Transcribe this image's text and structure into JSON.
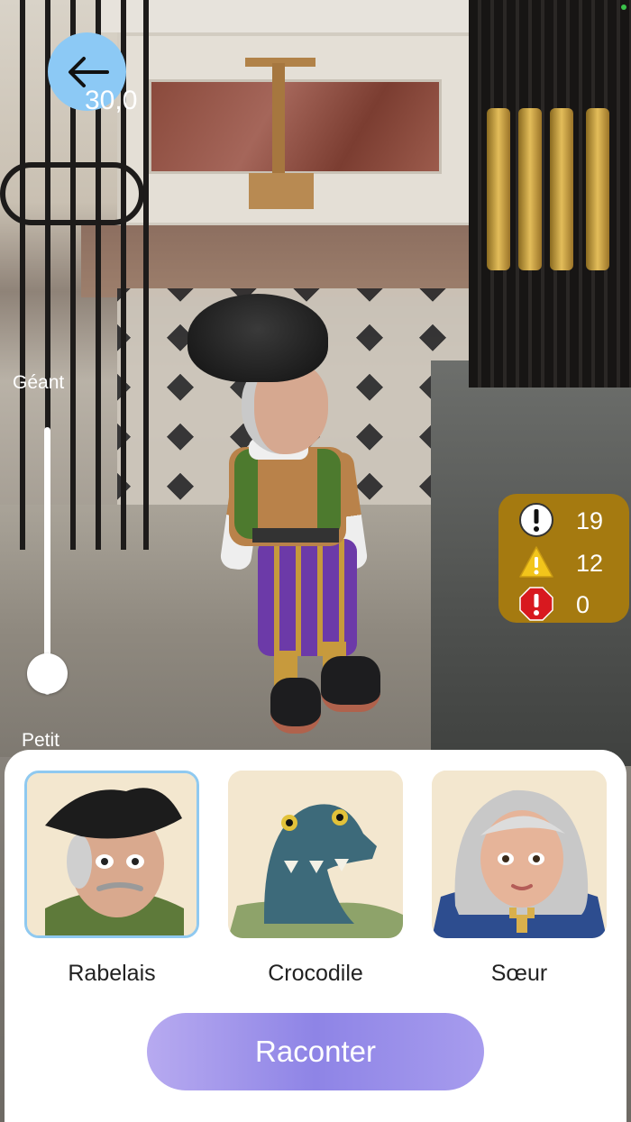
{
  "header": {
    "back_icon": "arrow-left-icon",
    "zoom_value": "30,0"
  },
  "size_slider": {
    "max_label": "Géant",
    "min_label": "Petit",
    "level_fraction": 0.08
  },
  "alerts": [
    {
      "icon": "info-exclamation-icon",
      "value": "19"
    },
    {
      "icon": "warning-triangle-icon",
      "value": "12"
    },
    {
      "icon": "stop-octagon-icon",
      "value": "0"
    }
  ],
  "characters": [
    {
      "label": "Rabelais",
      "selected": true
    },
    {
      "label": "Crocodile",
      "selected": false
    },
    {
      "label": "Sœur",
      "selected": false
    }
  ],
  "cta": {
    "label": "Raconter"
  },
  "colors": {
    "back_button": "#8cc9f5",
    "alerts_panel": "#a57a10",
    "cta_gradient_start": "#b7aaf0",
    "cta_gradient_mid": "#8e84e6",
    "selected_border": "#8fc9f0"
  }
}
